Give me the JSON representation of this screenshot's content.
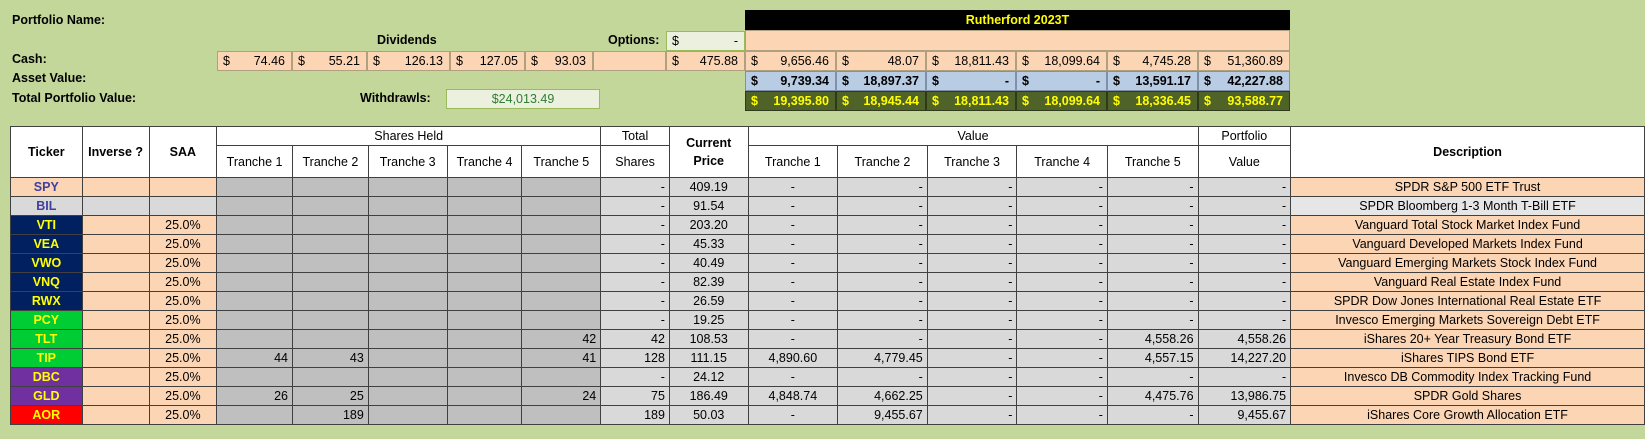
{
  "header": {
    "portfolio_name_label": "Portfolio Name:",
    "dividends_label": "Dividends",
    "options_label": "Options:",
    "cash_label": "Cash:",
    "asset_value_label": "Asset Value:",
    "total_value_label": "Total Portfolio Value:",
    "withdrawls_label": "Withdrawls:",
    "withdrawls_value": "$24,013.49",
    "options_value": "-",
    "options_cash": "475.88",
    "dividends": [
      "74.46",
      "55.21",
      "126.13",
      "127.05",
      "93.03"
    ],
    "portfolio_title": "Rutherford 2023T",
    "cash_tranches": [
      "9,656.46",
      "48.07",
      "18,811.43",
      "18,099.64",
      "4,745.28",
      "51,360.89"
    ],
    "asset_tranches": [
      "9,739.34",
      "18,897.37",
      "-",
      "-",
      "13,591.17",
      "42,227.88"
    ],
    "total_tranches": [
      "19,395.80",
      "18,945.44",
      "18,811.43",
      "18,099.64",
      "18,336.45",
      "93,588.77"
    ],
    "currency": "$"
  },
  "table": {
    "headers": {
      "ticker": "Ticker",
      "inverse": "Inverse ?",
      "saa": "SAA",
      "shares_held": "Shares Held",
      "tranche1": "Tranche 1",
      "tranche2": "Tranche 2",
      "tranche3": "Tranche 3",
      "tranche4": "Tranche 4",
      "tranche5": "Tranche 5",
      "total": "Total",
      "shares": "Shares",
      "current": "Current",
      "price": "Price",
      "value": "Value",
      "portfolio": "Portfolio",
      "value2": "Value",
      "description": "Description"
    },
    "rows": [
      {
        "ticker": "SPY",
        "style": "bg-peachtk",
        "inverse": "",
        "saa": "",
        "t1": "",
        "t2": "",
        "t3": "",
        "t4": "",
        "t5": "",
        "total": "-",
        "price": "409.19",
        "v1": "-",
        "v2": "-",
        "v3": "-",
        "v4": "-",
        "v5": "-",
        "pv": "-",
        "desc": "SPDR S&P 500 ETF Trust",
        "rowbg": "bg-peach"
      },
      {
        "ticker": "BIL",
        "style": "bg-lgraytk",
        "inverse": "",
        "saa": "",
        "t1": "",
        "t2": "",
        "t3": "",
        "t4": "",
        "t5": "",
        "total": "-",
        "price": "91.54",
        "v1": "-",
        "v2": "-",
        "v3": "-",
        "v4": "-",
        "v5": "-",
        "pv": "-",
        "desc": "SPDR Bloomberg 1-3 Month T-Bill ETF",
        "rowbg": "bg-lgray"
      },
      {
        "ticker": "VTI",
        "style": "bg-navy",
        "inverse": "",
        "saa": "25.0%",
        "t1": "",
        "t2": "",
        "t3": "",
        "t4": "",
        "t5": "",
        "total": "-",
        "price": "203.20",
        "v1": "-",
        "v2": "-",
        "v3": "-",
        "v4": "-",
        "v5": "-",
        "pv": "-",
        "desc": "Vanguard Total Stock Market Index Fund",
        "rowbg": "bg-peach"
      },
      {
        "ticker": "VEA",
        "style": "bg-navy",
        "inverse": "",
        "saa": "25.0%",
        "t1": "",
        "t2": "",
        "t3": "",
        "t4": "",
        "t5": "",
        "total": "-",
        "price": "45.33",
        "v1": "-",
        "v2": "-",
        "v3": "-",
        "v4": "-",
        "v5": "-",
        "pv": "-",
        "desc": "Vanguard Developed Markets Index Fund",
        "rowbg": "bg-peach"
      },
      {
        "ticker": "VWO",
        "style": "bg-navy",
        "inverse": "",
        "saa": "25.0%",
        "t1": "",
        "t2": "",
        "t3": "",
        "t4": "",
        "t5": "",
        "total": "-",
        "price": "40.49",
        "v1": "-",
        "v2": "-",
        "v3": "-",
        "v4": "-",
        "v5": "-",
        "pv": "-",
        "desc": "Vanguard Emerging Markets Stock Index Fund",
        "rowbg": "bg-peach"
      },
      {
        "ticker": "VNQ",
        "style": "bg-navy",
        "inverse": "",
        "saa": "25.0%",
        "t1": "",
        "t2": "",
        "t3": "",
        "t4": "",
        "t5": "",
        "total": "-",
        "price": "82.39",
        "v1": "-",
        "v2": "-",
        "v3": "-",
        "v4": "-",
        "v5": "-",
        "pv": "-",
        "desc": "Vanguard Real Estate Index Fund",
        "rowbg": "bg-peach"
      },
      {
        "ticker": "RWX",
        "style": "bg-navy",
        "inverse": "",
        "saa": "25.0%",
        "t1": "",
        "t2": "",
        "t3": "",
        "t4": "",
        "t5": "",
        "total": "-",
        "price": "26.59",
        "v1": "-",
        "v2": "-",
        "v3": "-",
        "v4": "-",
        "v5": "-",
        "pv": "-",
        "desc": "SPDR Dow Jones International Real Estate ETF",
        "rowbg": "bg-peach"
      },
      {
        "ticker": "PCY",
        "style": "bg-green",
        "inverse": "",
        "saa": "25.0%",
        "t1": "",
        "t2": "",
        "t3": "",
        "t4": "",
        "t5": "",
        "total": "-",
        "price": "19.25",
        "v1": "-",
        "v2": "-",
        "v3": "-",
        "v4": "-",
        "v5": "-",
        "pv": "-",
        "desc": "Invesco Emerging Markets Sovereign Debt ETF",
        "rowbg": "bg-peach"
      },
      {
        "ticker": "TLT",
        "style": "bg-green",
        "inverse": "",
        "saa": "25.0%",
        "t1": "",
        "t2": "",
        "t3": "",
        "t4": "",
        "t5": "42",
        "total": "42",
        "price": "108.53",
        "v1": "-",
        "v2": "-",
        "v3": "-",
        "v4": "-",
        "v5": "4,558.26",
        "pv": "4,558.26",
        "desc": "iShares 20+ Year Treasury Bond ETF",
        "rowbg": "bg-peach"
      },
      {
        "ticker": "TIP",
        "style": "bg-green",
        "inverse": "",
        "saa": "25.0%",
        "t1": "44",
        "t2": "43",
        "t3": "",
        "t4": "",
        "t5": "41",
        "total": "128",
        "price": "111.15",
        "v1": "4,890.60",
        "v2": "4,779.45",
        "v3": "-",
        "v4": "-",
        "v5": "4,557.15",
        "pv": "14,227.20",
        "desc": "iShares TIPS Bond ETF",
        "rowbg": "bg-peach"
      },
      {
        "ticker": "DBC",
        "style": "bg-purple",
        "inverse": "",
        "saa": "25.0%",
        "t1": "",
        "t2": "",
        "t3": "",
        "t4": "",
        "t5": "",
        "total": "-",
        "price": "24.12",
        "v1": "-",
        "v2": "-",
        "v3": "-",
        "v4": "-",
        "v5": "-",
        "pv": "-",
        "desc": "Invesco DB Commodity Index Tracking Fund",
        "rowbg": "bg-peach"
      },
      {
        "ticker": "GLD",
        "style": "bg-purple",
        "inverse": "",
        "saa": "25.0%",
        "t1": "26",
        "t2": "25",
        "t3": "",
        "t4": "",
        "t5": "24",
        "total": "75",
        "price": "186.49",
        "v1": "4,848.74",
        "v2": "4,662.25",
        "v3": "-",
        "v4": "-",
        "v5": "4,475.76",
        "pv": "13,986.75",
        "desc": "SPDR Gold Shares",
        "rowbg": "bg-peach"
      },
      {
        "ticker": "AOR",
        "style": "bg-red",
        "inverse": "",
        "saa": "25.0%",
        "t1": "",
        "t2": "189",
        "t3": "",
        "t4": "",
        "t5": "",
        "total": "189",
        "price": "50.03",
        "v1": "-",
        "v2": "9,455.67",
        "v3": "-",
        "v4": "-",
        "v5": "-",
        "pv": "9,455.67",
        "desc": "iShares Core Growth Allocation ETF",
        "rowbg": "bg-peach"
      }
    ]
  }
}
